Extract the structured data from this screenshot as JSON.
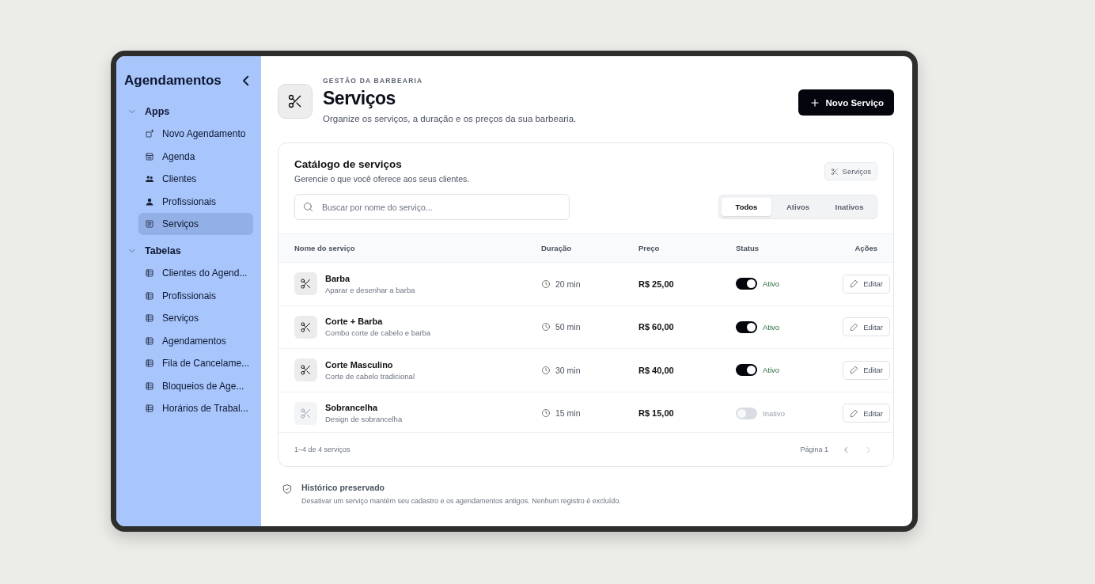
{
  "sidebar": {
    "title": "Agendamentos",
    "sections": [
      {
        "label": "Apps",
        "expanded": true,
        "items": [
          {
            "label": "Novo Agendamento",
            "kind": "new",
            "selected": false
          },
          {
            "label": "Agenda",
            "kind": "calendar",
            "selected": false
          },
          {
            "label": "Clientes",
            "kind": "users",
            "selected": false
          },
          {
            "label": "Profissionais",
            "kind": "user",
            "selected": false
          },
          {
            "label": "Serviços",
            "kind": "doc",
            "selected": true
          }
        ]
      },
      {
        "label": "Tabelas",
        "expanded": true,
        "items": [
          {
            "label": "Clientes do Agend...",
            "kind": "table",
            "selected": false
          },
          {
            "label": "Profissionais",
            "kind": "table",
            "selected": false
          },
          {
            "label": "Serviços",
            "kind": "table",
            "selected": false
          },
          {
            "label": "Agendamentos",
            "kind": "table",
            "selected": false
          },
          {
            "label": "Fila de Cancelame...",
            "kind": "table",
            "selected": false
          },
          {
            "label": "Bloqueios de Age...",
            "kind": "table",
            "selected": false
          },
          {
            "label": "Horários de Trabal...",
            "kind": "table",
            "selected": false
          }
        ]
      }
    ]
  },
  "header": {
    "eyebrow": "GESTÃO DA BARBEARIA",
    "title": "Serviços",
    "subtitle": "Organize os serviços, a duração e os preços da sua barbearia.",
    "button": "Novo Serviço"
  },
  "catalog": {
    "title": "Catálogo de serviços",
    "subtitle": "Gerencie o que você oferece aos seus clientes.",
    "badge": "Serviços",
    "search": {
      "placeholder": "Buscar por nome do serviço..."
    },
    "filters": [
      {
        "label": "Todos",
        "selected": true
      },
      {
        "label": "Ativos",
        "selected": false
      },
      {
        "label": "Inativos",
        "selected": false
      }
    ],
    "columns": [
      "Nome do serviço",
      "Duração",
      "Preço",
      "Status",
      "Ações"
    ],
    "rows": [
      {
        "name": "Barba",
        "description": "Aparar e desenhar a barba",
        "duration": "20 min",
        "price": "R$ 25,00",
        "on": true,
        "status": "Ativo",
        "action": "Editar"
      },
      {
        "name": "Corte + Barba",
        "description": "Combo corte de cabelo e barba",
        "duration": "50 min",
        "price": "R$ 60,00",
        "on": true,
        "status": "Ativo",
        "action": "Editar"
      },
      {
        "name": "Corte Masculino",
        "description": "Corte de cabelo tradicional",
        "duration": "30 min",
        "price": "R$ 40,00",
        "on": true,
        "status": "Ativo",
        "action": "Editar"
      },
      {
        "name": "Sobrancelha",
        "description": "Design de sobrancelha",
        "duration": "15 min",
        "price": "R$ 15,00",
        "on": false,
        "status": "Inativo",
        "action": "Editar"
      }
    ],
    "range": "1–4 de 4 serviços",
    "page": "Página 1"
  },
  "note": {
    "title": "Histórico preservado",
    "text": "Desativar um serviço mantém seu cadastro e os agendamentos antigos. Nenhum registro é excluído."
  }
}
